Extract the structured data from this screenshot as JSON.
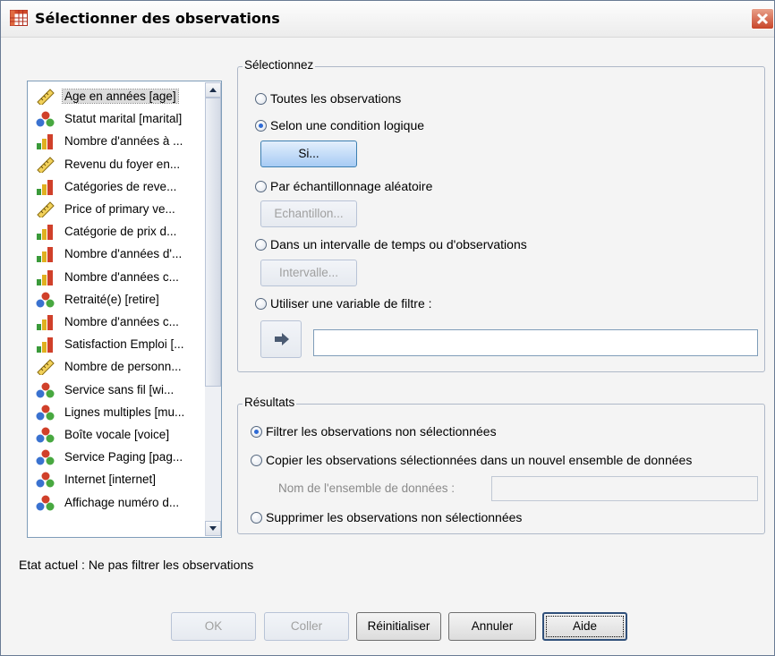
{
  "window": {
    "title": "Sélectionner des observations",
    "icon": "table-icon",
    "colors": {
      "accent": "#2d6ad5",
      "close": "#c8452a"
    }
  },
  "variables": {
    "items": [
      {
        "label": "Age en années [age]",
        "icon": "ruler-icon",
        "selected": true
      },
      {
        "label": "Statut marital [marital]",
        "icon": "balls-icon",
        "selected": false
      },
      {
        "label": "Nombre d'années à ...",
        "icon": "bar-chart-icon",
        "selected": false
      },
      {
        "label": "Revenu du foyer en...",
        "icon": "ruler-icon",
        "selected": false
      },
      {
        "label": "Catégories de reve...",
        "icon": "bar-chart-icon",
        "selected": false
      },
      {
        "label": "Price of primary ve...",
        "icon": "ruler-icon",
        "selected": false
      },
      {
        "label": "Catégorie de prix d...",
        "icon": "bar-chart-icon",
        "selected": false
      },
      {
        "label": "Nombre d'années d'...",
        "icon": "bar-chart-icon",
        "selected": false
      },
      {
        "label": "Nombre d'années c...",
        "icon": "bar-chart-icon",
        "selected": false
      },
      {
        "label": "Retraité(e) [retire]",
        "icon": "balls-icon",
        "selected": false
      },
      {
        "label": "Nombre d'années c...",
        "icon": "bar-chart-icon",
        "selected": false
      },
      {
        "label": "Satisfaction Emploi [...",
        "icon": "bar-chart-icon",
        "selected": false
      },
      {
        "label": "Nombre de personn...",
        "icon": "ruler-icon",
        "selected": false
      },
      {
        "label": "Service sans fil [wi...",
        "icon": "balls-icon",
        "selected": false
      },
      {
        "label": "Lignes multiples [mu...",
        "icon": "balls-icon",
        "selected": false
      },
      {
        "label": "Boîte vocale [voice]",
        "icon": "balls-icon",
        "selected": false
      },
      {
        "label": "Service Paging [pag...",
        "icon": "balls-icon",
        "selected": false
      },
      {
        "label": "Internet [internet]",
        "icon": "balls-icon",
        "selected": false
      },
      {
        "label": "Affichage numéro d...",
        "icon": "balls-icon",
        "selected": false
      }
    ]
  },
  "select_group": {
    "title": "Sélectionnez",
    "options": {
      "all": "Toutes les observations",
      "condition": "Selon une condition logique",
      "random": "Par échantillonnage aléatoire",
      "range": "Dans un intervalle de temps ou d'observations",
      "filter": "Utiliser une variable de filtre :"
    },
    "selected": "condition",
    "buttons": {
      "if": "Si...",
      "sample": "Echantillon...",
      "range": "Intervalle..."
    },
    "filter_value": ""
  },
  "results_group": {
    "title": "Résultats",
    "options": {
      "filter": "Filtrer les observations non sélectionnées",
      "copy": "Copier les observations sélectionnées dans un nouvel ensemble de données",
      "delete": "Supprimer les observations non sélectionnées"
    },
    "selected": "filter",
    "dataset_label": "Nom de l'ensemble de données :",
    "dataset_value": ""
  },
  "status": "Etat actuel : Ne pas filtrer les observations",
  "footer": {
    "ok": "OK",
    "paste": "Coller",
    "reset": "Réinitialiser",
    "cancel": "Annuler",
    "help": "Aide"
  }
}
